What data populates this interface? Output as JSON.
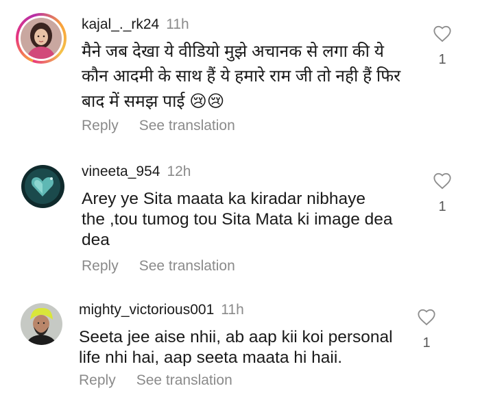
{
  "comments": [
    {
      "username": "kajal_._rk24",
      "time": "11h",
      "line1": "मैने जब देखा ये वीडियो मुझे अचानक से लगा की ये",
      "line2": "कौन आदमी के साथ हैं ये हमारे राम जी तो नही हैं फिर",
      "line3": "बाद में समझ पाई",
      "emoji": "😢😢",
      "reply": "Reply",
      "see_translation": "See translation",
      "likes": "1"
    },
    {
      "username": "vineeta_954",
      "time": "12h",
      "line1": "Arey ye Sita maata ka kiradar nibhaye",
      "line2": "the ,tou tumog tou Sita Mata ki image dea",
      "line3": "dea",
      "reply": "Reply",
      "see_translation": "See translation",
      "likes": "1"
    },
    {
      "username": "mighty_victorious001",
      "time": "11h",
      "line1": "Seeta jee aise nhii, ab aap kii koi personal",
      "line2": "life nhi hai, aap seeta maata hi haii.",
      "reply": "Reply",
      "see_translation": "See translation",
      "likes": "1"
    }
  ]
}
